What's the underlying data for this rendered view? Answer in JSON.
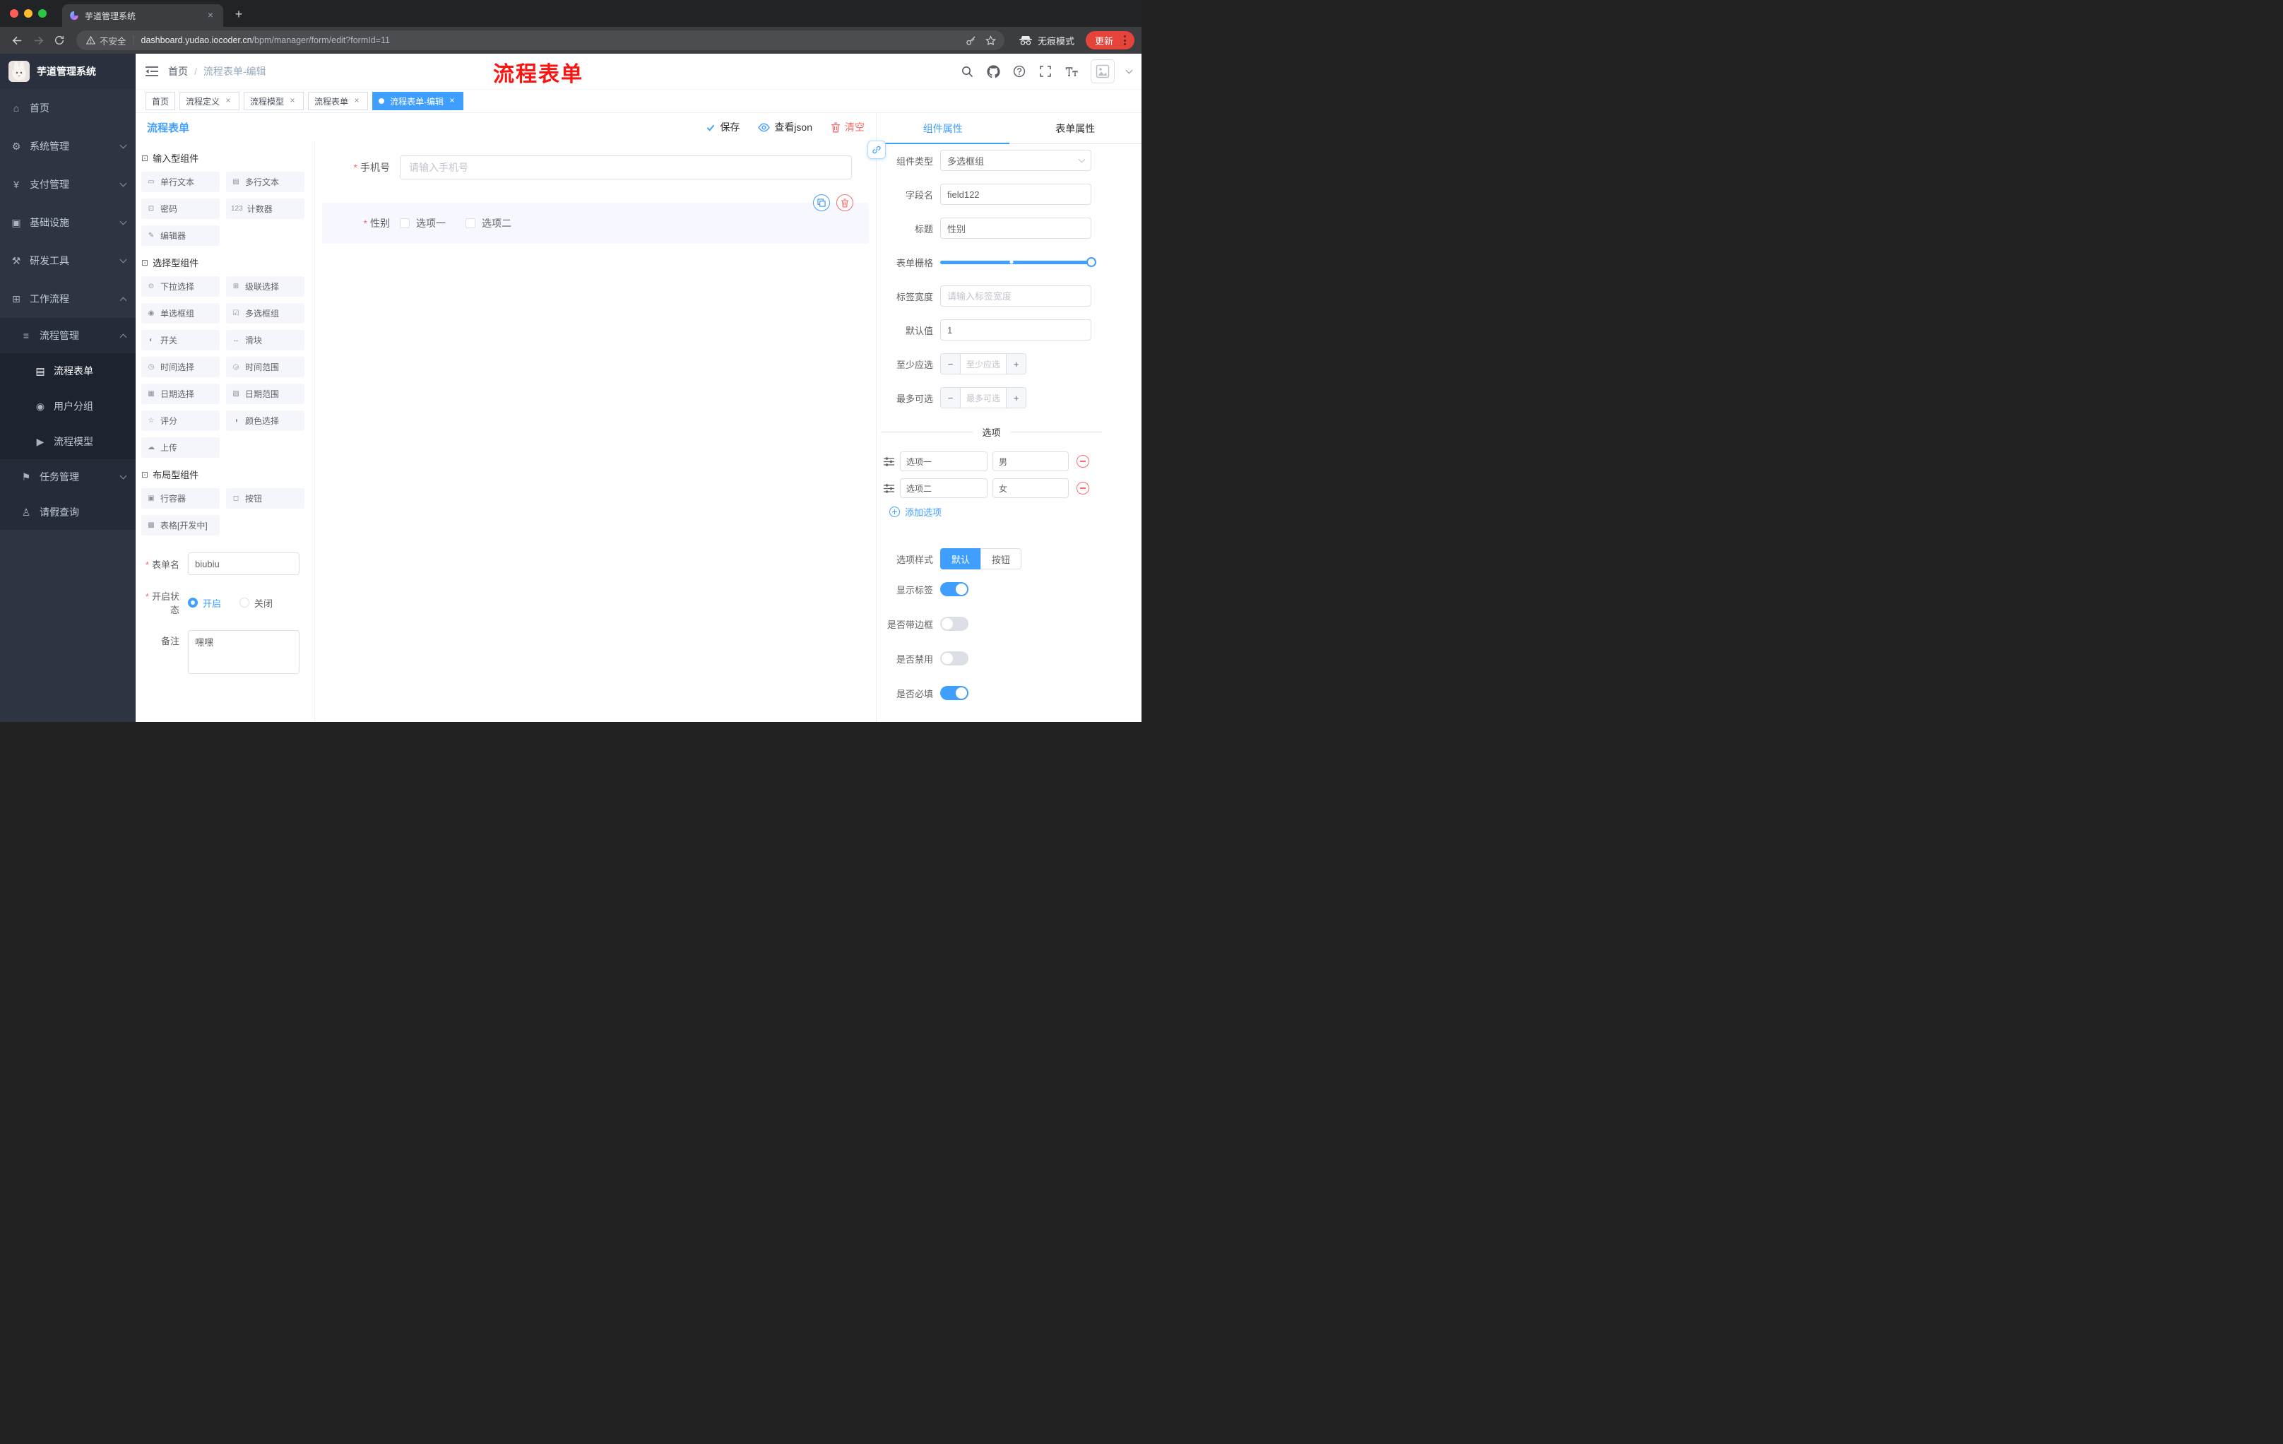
{
  "colors": {
    "accent": "#409eff",
    "danger": "#f56c6c",
    "annotation_red": "#fb1410",
    "sidebar_bg": "#2f3443",
    "update_pill": "#e5443a",
    "tag_active": "#409eff"
  },
  "browser": {
    "tab_title": "芋道管理系统",
    "security_label": "不安全",
    "url_domain": "dashboard.yudao.iocoder.cn",
    "url_path": "/bpm/manager/form/edit?formId=11",
    "incognito_label": "无痕模式",
    "update_label": "更新"
  },
  "sidebar": {
    "logo_title": "芋道管理系统",
    "items": [
      {
        "icon": "⌂",
        "label": "首页"
      },
      {
        "icon": "⚙",
        "label": "系统管理"
      },
      {
        "icon": "¥",
        "label": "支付管理"
      },
      {
        "icon": "▣",
        "label": "基础设施"
      },
      {
        "icon": "⚒",
        "label": "研发工具"
      },
      {
        "icon": "⊞",
        "label": "工作流程"
      },
      {
        "icon": "≡",
        "label": "流程管理"
      },
      {
        "icon": "▤",
        "label": "流程表单"
      },
      {
        "icon": "◉",
        "label": "用户分组"
      },
      {
        "icon": "▶",
        "label": "流程模型"
      },
      {
        "icon": "⚑",
        "label": "任务管理"
      },
      {
        "icon": "♙",
        "label": "请假查询"
      }
    ]
  },
  "header": {
    "breadcrumb_home": "首页",
    "breadcrumb_current": "流程表单-编辑",
    "annotation": "流程表单"
  },
  "tags": [
    {
      "label": "首页"
    },
    {
      "label": "流程定义"
    },
    {
      "label": "流程模型"
    },
    {
      "label": "流程表单"
    },
    {
      "label": "流程表单-编辑"
    }
  ],
  "designer": {
    "title": "流程表单",
    "save_label": "保存",
    "view_json_label": "查看json",
    "clear_label": "清空"
  },
  "components": {
    "groups": [
      {
        "title": "输入型组件",
        "items": [
          {
            "icon": "▭",
            "label": "单行文本"
          },
          {
            "icon": "▤",
            "label": "多行文本"
          },
          {
            "icon": "⊡",
            "label": "密码"
          },
          {
            "icon": "123",
            "label": "计数器"
          },
          {
            "icon": "✎",
            "label": "编辑器"
          }
        ]
      },
      {
        "title": "选择型组件",
        "items": [
          {
            "icon": "⊙",
            "label": "下拉选择"
          },
          {
            "icon": "⊞",
            "label": "级联选择"
          },
          {
            "icon": "◉",
            "label": "单选框组"
          },
          {
            "icon": "☑",
            "label": "多选框组"
          },
          {
            "icon": "◐",
            "label": "开关"
          },
          {
            "icon": "↔",
            "label": "滑块"
          },
          {
            "icon": "◷",
            "label": "时间选择"
          },
          {
            "icon": "◶",
            "label": "时间范围"
          },
          {
            "icon": "▦",
            "label": "日期选择"
          },
          {
            "icon": "▧",
            "label": "日期范围"
          },
          {
            "icon": "☆",
            "label": "评分"
          },
          {
            "icon": "◑",
            "label": "颜色选择"
          },
          {
            "icon": "☁",
            "label": "上传"
          }
        ]
      },
      {
        "title": "布局型组件",
        "items": [
          {
            "icon": "▣",
            "label": "行容器"
          },
          {
            "icon": "◻",
            "label": "按钮"
          },
          {
            "icon": "▩",
            "label": "表格[开发中]"
          }
        ]
      }
    ]
  },
  "meta": {
    "name_label": "表单名",
    "name_value": "biubiu",
    "status_label": "开启状态",
    "status_on": "开启",
    "status_off": "关闭",
    "remark_label": "备注",
    "remark_value": "嘿嘿"
  },
  "canvas": {
    "phone_label": "手机号",
    "phone_placeholder": "请输入手机号",
    "gender_label": "性别",
    "gender_option1": "选项一",
    "gender_option2": "选项二"
  },
  "props": {
    "tab_component": "组件属性",
    "tab_form": "表单属性",
    "rows": {
      "component_type_label": "组件类型",
      "component_type_value": "多选框组",
      "field_name_label": "字段名",
      "field_name_value": "field122",
      "title_label": "标题",
      "title_value": "性别",
      "grid_label": "表单栅格",
      "tag_width_label": "标签宽度",
      "tag_width_placeholder": "请输入标签宽度",
      "default_label": "默认值",
      "default_value": "1",
      "min_label": "至少应选",
      "min_placeholder": "至少应选",
      "max_label": "最多可选",
      "max_placeholder": "最多可选"
    },
    "options_divider": "选项",
    "options": [
      {
        "label": "选项一",
        "value": "男"
      },
      {
        "label": "选项二",
        "value": "女"
      }
    ],
    "add_option_label": "添加选项",
    "style_label": "选项样式",
    "style_default": "默认",
    "style_button": "按钮",
    "show_label_label": "显示标签",
    "border_label": "是否带边框",
    "disabled_label": "是否禁用",
    "required_label": "是否必填"
  }
}
